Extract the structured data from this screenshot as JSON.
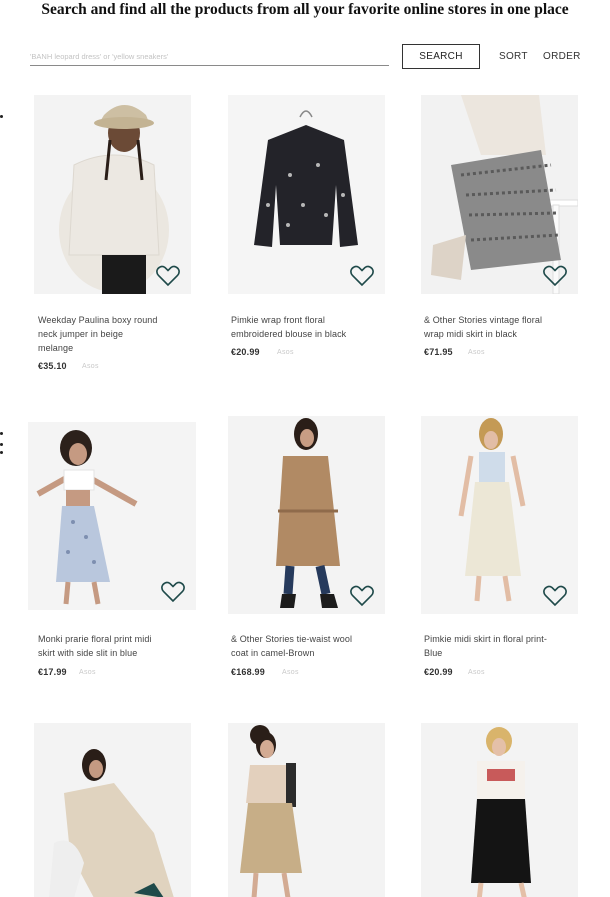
{
  "header": {
    "headline": "Search and find all the products from all your favorite online stores in one place"
  },
  "search": {
    "placeholder": "'BANH leopard dress' or 'yellow sneakers'",
    "value": "",
    "button_label": "SEARCH"
  },
  "controls": {
    "sort_label": "SORT",
    "order_label": "ORDER"
  },
  "colors": {
    "heart_outline": "#1f4a4a",
    "store_text": "#c9c9c9"
  },
  "products": [
    {
      "title_lines": [
        "Weekday Paulina boxy round",
        "neck jumper in beige",
        "melange"
      ],
      "price": "€35.10",
      "store": "Asos"
    },
    {
      "title_lines": [
        "Pimkie wrap front floral",
        "embroidered blouse in black"
      ],
      "price": "€20.99",
      "store": "Asos"
    },
    {
      "title_lines": [
        "& Other Stories vintage floral",
        "wrap midi skirt in black"
      ],
      "price": "€71.95",
      "store": "Asos"
    },
    {
      "title_lines": [
        "Monki prarie floral print midi",
        "skirt with side slit in blue"
      ],
      "price": "€17.99",
      "store": "Asos"
    },
    {
      "title_lines": [
        "& Other Stories tie-waist wool",
        "coat in camel-Brown"
      ],
      "price": "€168.99",
      "store": "Asos"
    },
    {
      "title_lines": [
        "Pimkie midi skirt in floral print-",
        "Blue"
      ],
      "price": "€20.99",
      "store": "Asos"
    },
    {
      "title_lines": [],
      "price": "",
      "store": ""
    },
    {
      "title_lines": [],
      "price": "",
      "store": ""
    },
    {
      "title_lines": [],
      "price": "",
      "store": ""
    }
  ]
}
